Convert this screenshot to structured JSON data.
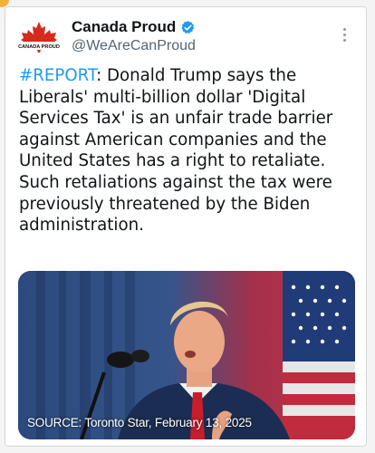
{
  "post": {
    "author": {
      "display_name": "Canada Proud",
      "handle": "@WeAreCanProud",
      "avatar_text": "CANADA PROUD",
      "verified": true,
      "avatar_icon": "maple-leaf-icon",
      "verified_icon": "verified-badge-icon"
    },
    "more_icon": "more-options-icon",
    "hashtag": "#REPORT",
    "body": ": Donald Trump says the Liberals' multi-billion dollar 'Digital Services Tax' is an unfair trade barrier against American companies and the United States has a right to retaliate. Such retaliations against the tax were previously threatened by the Biden administration.",
    "media": {
      "caption": "SOURCE: Toronto Star, February 13, 2025"
    }
  },
  "colors": {
    "hashtag": "#1d9bf0",
    "verified": "#1d9bf0",
    "maple_leaf": "#d52b1e",
    "text": "#0f1419",
    "muted": "#536471"
  }
}
